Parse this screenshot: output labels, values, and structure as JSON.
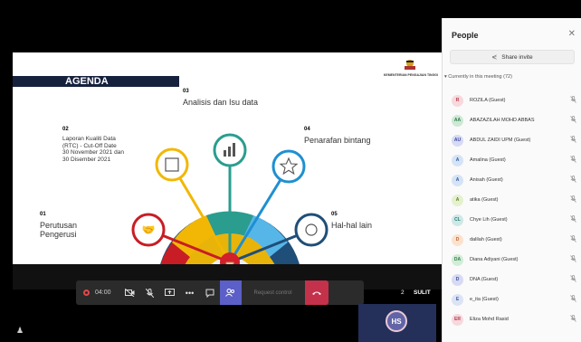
{
  "slide": {
    "agenda_title": "AGENDA",
    "ministry": "KEMENTERIAN PENGAJIAN TINGGI",
    "items": [
      {
        "num": "01",
        "title": "Perutusan\nPengerusi",
        "color": "#c81d25"
      },
      {
        "num": "02",
        "title": "Laporan Kualiti Data\n(RTC) - Cut-Off Date\n30 November 2021 dan\n30 Disember 2021",
        "color": "#f2b705"
      },
      {
        "num": "03",
        "title": "Analisis dan Isu data",
        "color": "#2a9d8f"
      },
      {
        "num": "04",
        "title": "Penarafan bintang",
        "color": "#1f8fd1"
      },
      {
        "num": "05",
        "title": "Hal-hal lain",
        "color": "#1f4e79"
      }
    ],
    "slide_number": "2",
    "classification": "SULIT"
  },
  "toolbar": {
    "record_time": "04:00",
    "request_control": "Request control",
    "icons": [
      "camera-off-icon",
      "mic-off-icon",
      "share-screen-icon",
      "more-icon",
      "chat-icon",
      "people-icon",
      "leave-icon"
    ]
  },
  "self_view": {
    "initials": "HS"
  },
  "people": {
    "title": "People",
    "share_invite": "Share invite",
    "section_label": "Currently in this meeting (72)",
    "participants": [
      {
        "initials": "R",
        "name": "ROZILA (Guest)",
        "bg": "#f6d9dd",
        "fg": "#b33a4c"
      },
      {
        "initials": "AA",
        "name": "ABAZAZILAH MOHD ABBAS",
        "bg": "#cfe8d6",
        "fg": "#2f7d4a"
      },
      {
        "initials": "AU",
        "name": "ABDUL ZAIDI UPM (Guest)",
        "bg": "#d6daf3",
        "fg": "#3c4a9c"
      },
      {
        "initials": "A",
        "name": "Amalina (Guest)",
        "bg": "#d6e3f5",
        "fg": "#2d5aa0"
      },
      {
        "initials": "A",
        "name": "Anisah (Guest)",
        "bg": "#d6e3f5",
        "fg": "#2d5aa0"
      },
      {
        "initials": "A",
        "name": "atika (Guest)",
        "bg": "#e5f0cf",
        "fg": "#5b7d1f"
      },
      {
        "initials": "CL",
        "name": "Chye Lih (Guest)",
        "bg": "#cfe8e6",
        "fg": "#1f7a72"
      },
      {
        "initials": "D",
        "name": "dalilah (Guest)",
        "bg": "#fbe2cf",
        "fg": "#c0622a"
      },
      {
        "initials": "DA",
        "name": "Diana Adiyani (Guest)",
        "bg": "#d2ecd8",
        "fg": "#2f7d4a"
      },
      {
        "initials": "D",
        "name": "DNA (Guest)",
        "bg": "#d6daf3",
        "fg": "#3c4a9c"
      },
      {
        "initials": "E",
        "name": "e_ita (Guest)",
        "bg": "#dbe3f5",
        "fg": "#3c5aa0"
      },
      {
        "initials": "ER",
        "name": "Eliza Mohd Rasid",
        "bg": "#f6d9dd",
        "fg": "#b33a4c"
      }
    ]
  }
}
